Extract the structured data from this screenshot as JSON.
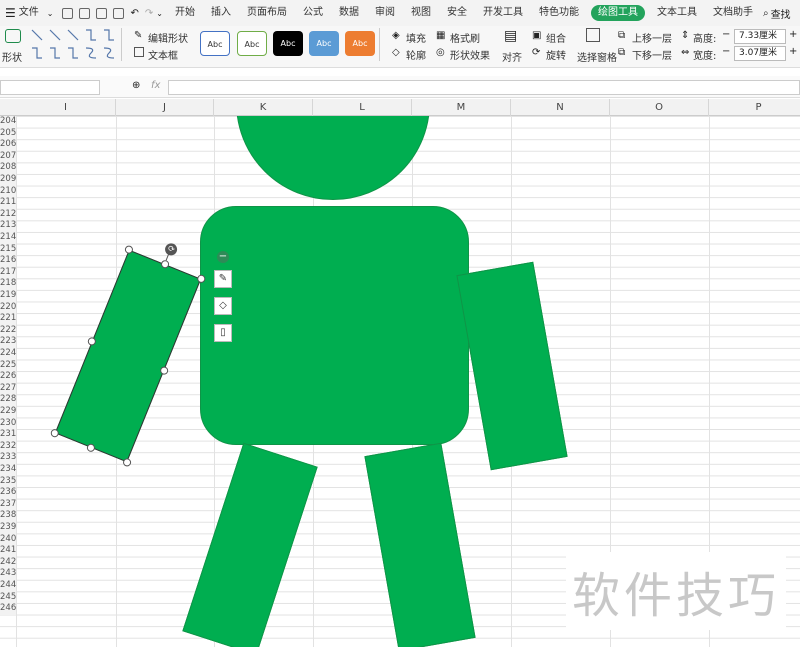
{
  "menubar": {
    "file": "文件",
    "tabs": [
      "开始",
      "插入",
      "页面布局",
      "公式",
      "数据",
      "审阅",
      "视图",
      "安全",
      "开发工具",
      "特色功能",
      "绘图工具",
      "文本工具",
      "文档助手"
    ],
    "active_tab": "绘图工具",
    "search": "查找"
  },
  "ribbon": {
    "shape": "形状",
    "edit_shape": "编辑形状",
    "textbox": "文本框",
    "styles": [
      "Abc",
      "Abc",
      "Abc",
      "Abc",
      "Abc"
    ],
    "fill": "填充",
    "format_brush": "格式刷",
    "outline": "轮廓",
    "shape_effect": "形状效果",
    "align": "对齐",
    "group": "组合",
    "rotate": "旋转",
    "selection_pane": "选择窗格",
    "bring_forward": "上移一层",
    "send_backward": "下移一层",
    "height_label": "高度:",
    "height_value": "7.33厘米",
    "width_label": "宽度:",
    "width_value": "3.07厘米"
  },
  "formula": {
    "fx": "fx"
  },
  "columns": [
    "I",
    "J",
    "K",
    "L",
    "M",
    "N",
    "O",
    "P"
  ],
  "rows": [
    "204",
    "205",
    "206",
    "207",
    "208",
    "209",
    "210",
    "211",
    "212",
    "213",
    "214",
    "215",
    "216",
    "217",
    "218",
    "219",
    "220",
    "221",
    "222",
    "223",
    "224",
    "225",
    "226",
    "227",
    "228",
    "229",
    "230",
    "231",
    "232",
    "233",
    "234",
    "235",
    "236",
    "237",
    "238",
    "239",
    "240",
    "241",
    "242",
    "243",
    "244",
    "245",
    "246"
  ],
  "watermark": "软件技巧",
  "colors": {
    "shape_fill": "#00ae50",
    "accent": "#23a35c",
    "style_colors": [
      "#ffffff",
      "#ffffff",
      "#000000",
      "#5b9bd5",
      "#ed7d31"
    ]
  },
  "icons": [
    "menu-icon",
    "save-icon",
    "print-icon",
    "undo-icon",
    "redo-icon",
    "search-icon",
    "zoom-icon",
    "rotate-handle-icon",
    "minus-icon",
    "pen-icon",
    "fill-icon",
    "crop-icon"
  ]
}
